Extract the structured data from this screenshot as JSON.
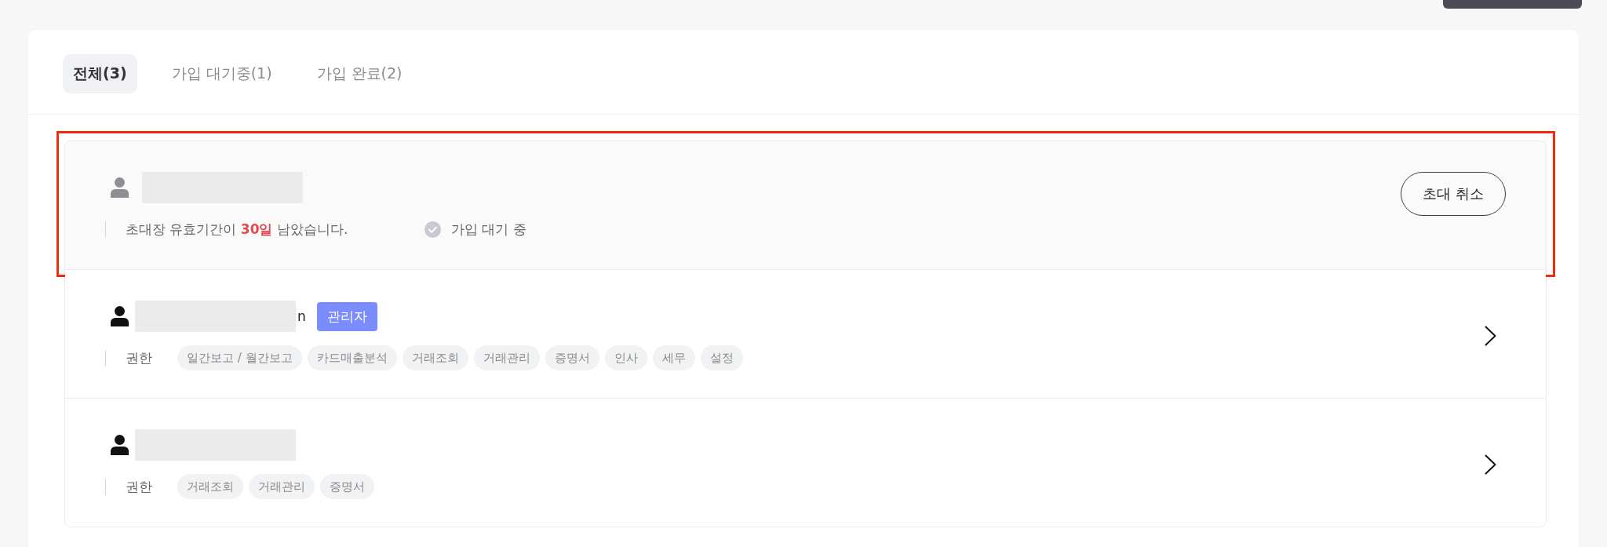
{
  "tabs": [
    {
      "label": "전체(3)",
      "selected": true
    },
    {
      "label": "가입 대기중(1)",
      "selected": false
    },
    {
      "label": "가입 완료(2)",
      "selected": false
    }
  ],
  "members": [
    {
      "kind": "invite",
      "highlighted": true,
      "expiry_notice": "초대장 유효기간이 **30일** 남았습니다.",
      "status_label": "가입 대기 중",
      "action": "초대 취소"
    },
    {
      "kind": "member",
      "highlighted": false,
      "name_fragment": "n",
      "role_badge": "관리자",
      "permissions_label": "권한",
      "permissions": [
        "일간보고 / 월간보고",
        "카드매출분석",
        "거래조회",
        "거래관리",
        "증명서",
        "인사",
        "세무",
        "설정"
      ]
    },
    {
      "kind": "member",
      "highlighted": false,
      "permissions_label": "권한",
      "permissions": [
        "거래조회",
        "거래관리",
        "증명서"
      ]
    }
  ]
}
